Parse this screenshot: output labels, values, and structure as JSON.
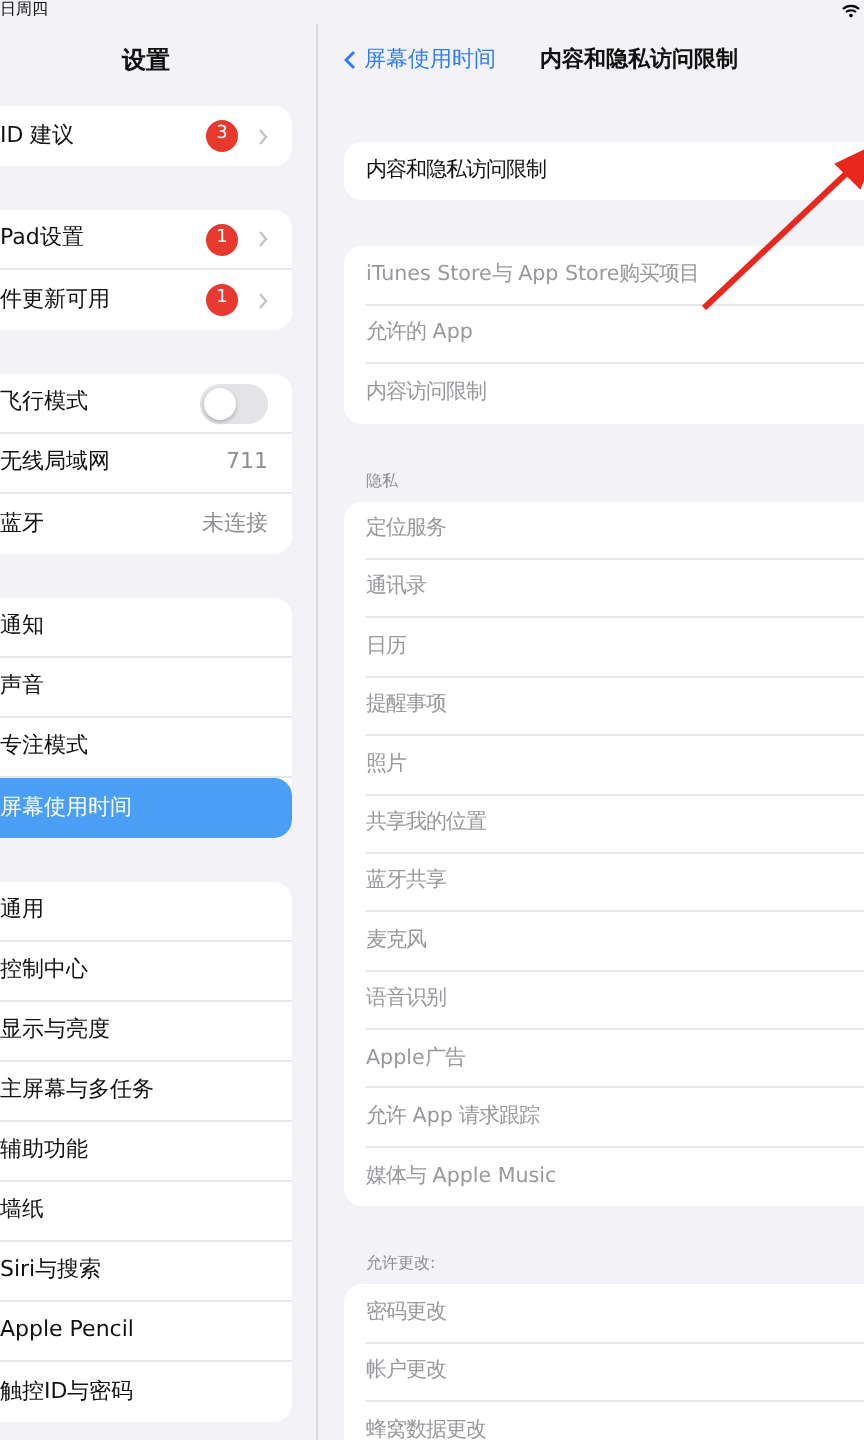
{
  "status_bar": {
    "date": "日周四"
  },
  "sidebar": {
    "title": "设置",
    "groups": [
      [
        {
          "kind": "link",
          "label": "ID 建议",
          "badge": "3",
          "selected": false
        }
      ],
      [
        {
          "kind": "link",
          "label": "Pad设置",
          "badge": "1",
          "selected": false
        },
        {
          "kind": "link",
          "label": "件更新可用",
          "badge": "1",
          "selected": false
        }
      ],
      [
        {
          "kind": "toggle",
          "label": "飞行模式",
          "on": false,
          "selected": false
        },
        {
          "kind": "value",
          "label": "无线局域网",
          "value": "711",
          "selected": false
        },
        {
          "kind": "value",
          "label": "蓝牙",
          "value": "未连接",
          "selected": false
        }
      ],
      [
        {
          "kind": "plain",
          "label": "通知",
          "selected": false
        },
        {
          "kind": "plain",
          "label": "声音",
          "selected": false
        },
        {
          "kind": "plain",
          "label": "专注模式",
          "selected": false
        },
        {
          "kind": "plain",
          "label": "屏幕使用时间",
          "selected": true
        }
      ],
      [
        {
          "kind": "plain",
          "label": "通用",
          "selected": false
        },
        {
          "kind": "plain",
          "label": "控制中心",
          "selected": false
        },
        {
          "kind": "plain",
          "label": "显示与亮度",
          "selected": false
        },
        {
          "kind": "plain",
          "label": "主屏幕与多任务",
          "selected": false
        },
        {
          "kind": "plain",
          "label": "辅助功能",
          "selected": false
        },
        {
          "kind": "plain",
          "label": "墙纸",
          "selected": false
        },
        {
          "kind": "plain",
          "label": "Siri与搜索",
          "selected": false
        },
        {
          "kind": "plain",
          "label": "Apple Pencil",
          "selected": false
        },
        {
          "kind": "plain",
          "label": "触控ID与密码",
          "selected": false
        }
      ]
    ]
  },
  "detail": {
    "back": "屏幕使用时间",
    "title": "内容和隐私访问限制",
    "sections": [
      {
        "rows": [
          {
            "label": "内容和隐私访问限制",
            "disabled": false
          }
        ]
      },
      {
        "rows": [
          {
            "label": "iTunes Store与 App Store购买项目",
            "disabled": true
          },
          {
            "label": "允许的 App",
            "disabled": true
          },
          {
            "label": "内容访问限制",
            "disabled": true
          }
        ]
      },
      {
        "header": "隐私",
        "rows": [
          {
            "label": "定位服务",
            "disabled": true
          },
          {
            "label": "通讯录",
            "disabled": true
          },
          {
            "label": "日历",
            "disabled": true
          },
          {
            "label": "提醒事项",
            "disabled": true
          },
          {
            "label": "照片",
            "disabled": true
          },
          {
            "label": "共享我的位置",
            "disabled": true
          },
          {
            "label": "蓝牙共享",
            "disabled": true
          },
          {
            "label": "麦克风",
            "disabled": true
          },
          {
            "label": "语音识别",
            "disabled": true
          },
          {
            "label": "Apple广告",
            "disabled": true
          },
          {
            "label": "允许 App 请求跟踪",
            "disabled": true
          },
          {
            "label": "媒体与 Apple Music",
            "disabled": true
          }
        ]
      },
      {
        "header": "允许更改:",
        "rows": [
          {
            "label": "密码更改",
            "disabled": true
          },
          {
            "label": "帐户更改",
            "disabled": true
          },
          {
            "label": "蜂窝数据更改",
            "disabled": true
          }
        ]
      }
    ]
  }
}
